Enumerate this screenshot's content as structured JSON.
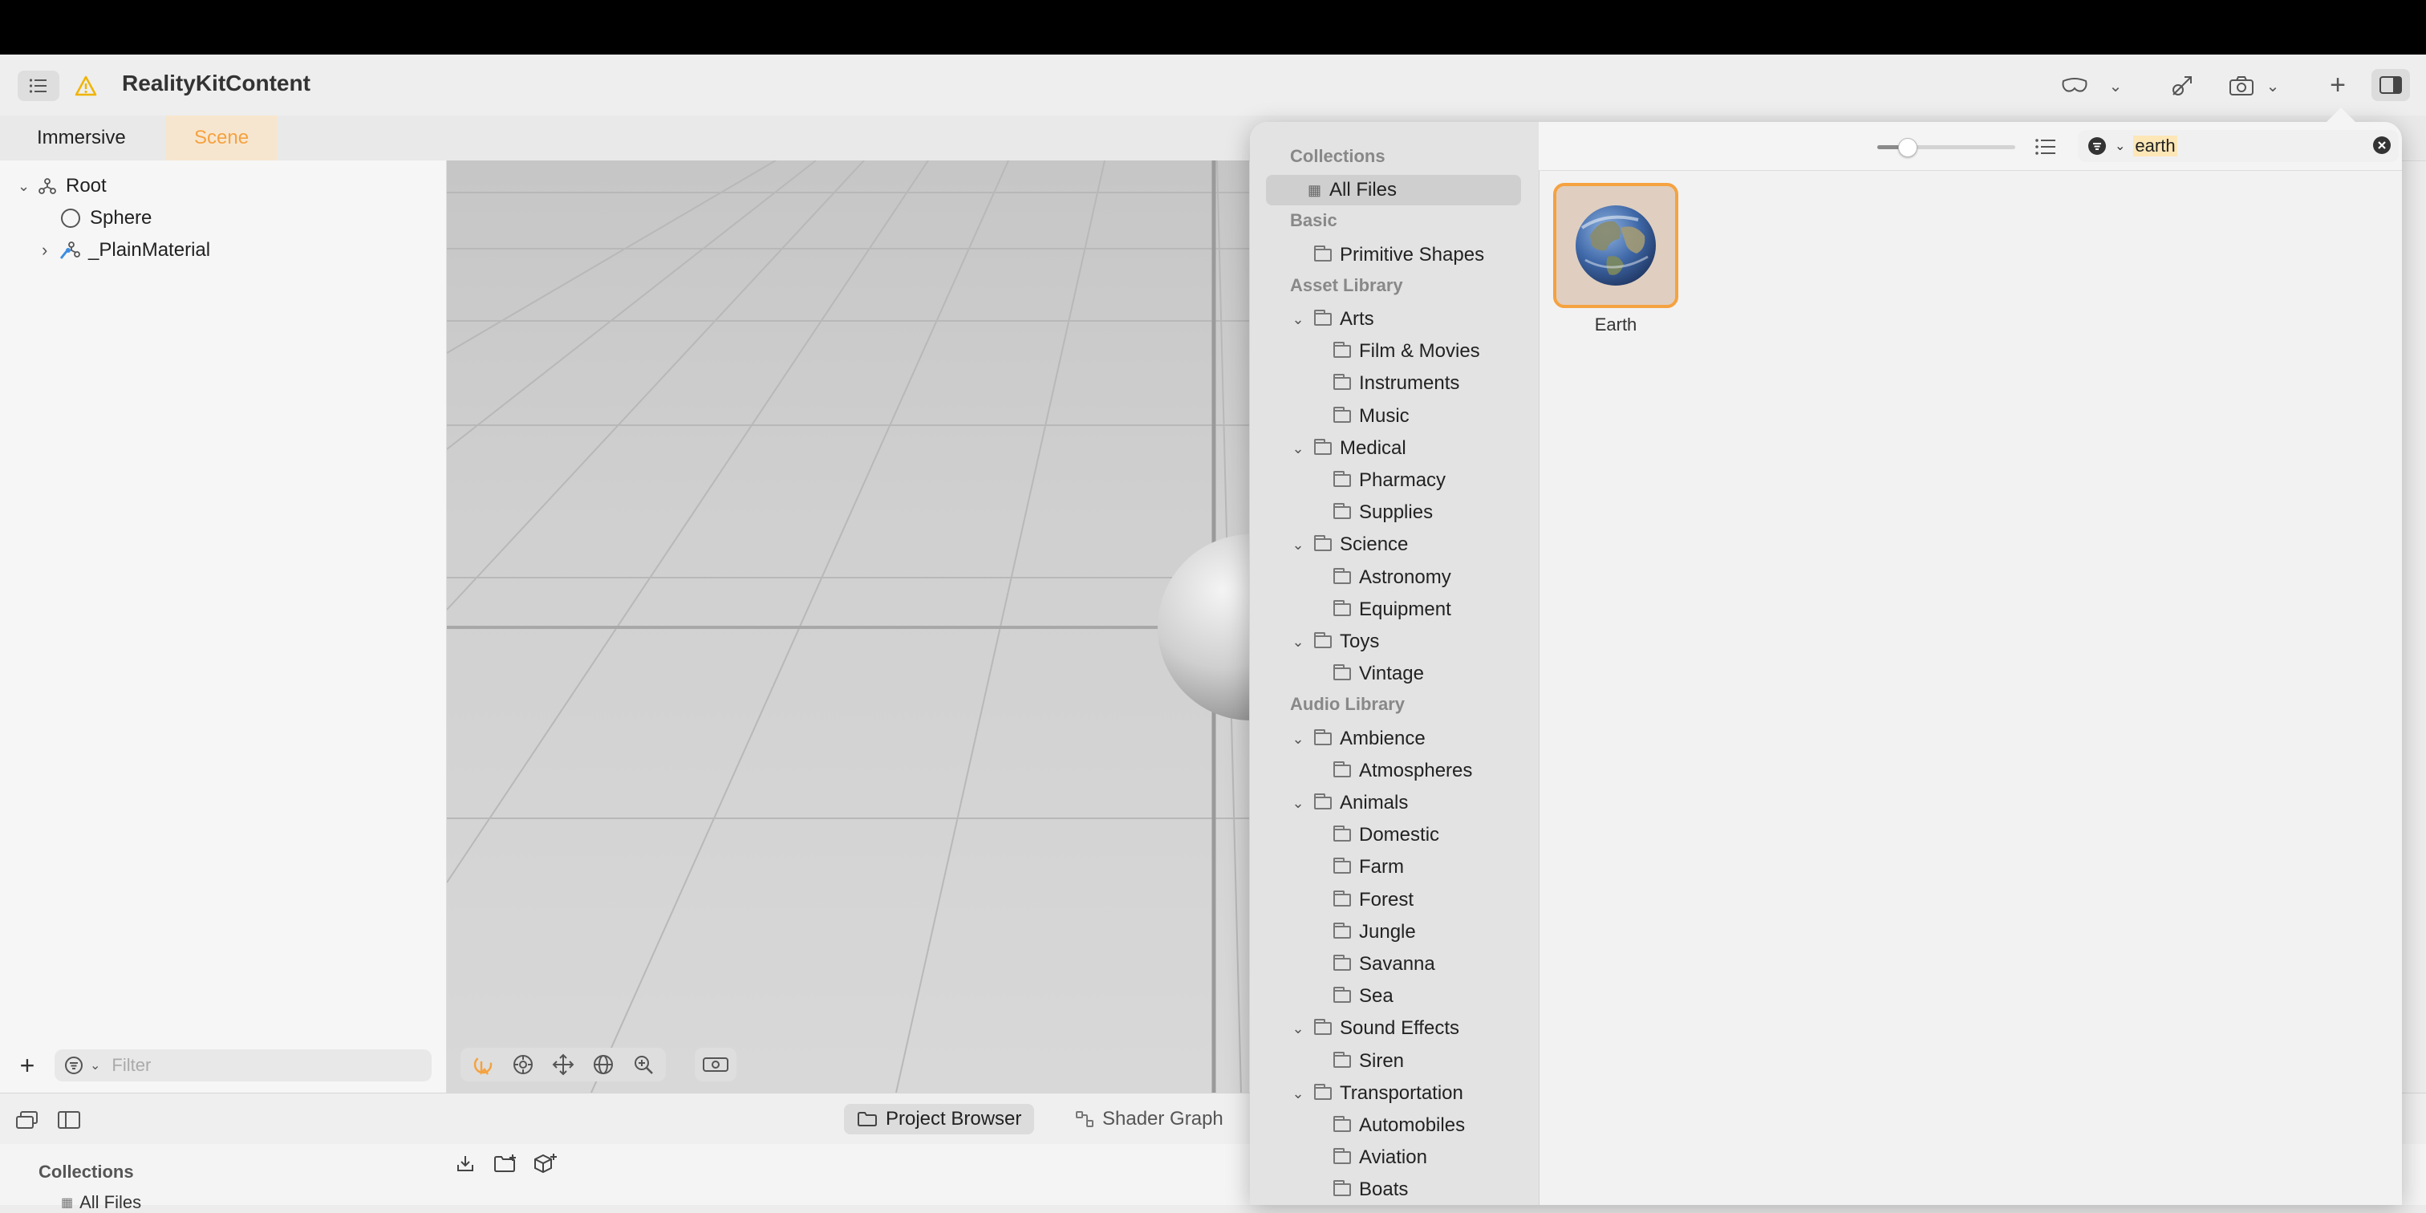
{
  "app": {
    "title": "RealityKitContent",
    "accent_color": "#f5a240",
    "warning_color": "#f0b400"
  },
  "toolbar": {
    "icons": [
      "list-icon",
      "warning-icon",
      "headset-icon",
      "chevron-down-icon",
      "transform-icon",
      "camera-icon",
      "plus-icon",
      "inspector-icon"
    ]
  },
  "scene_tabs": [
    {
      "label": "Immersive",
      "selected": false
    },
    {
      "label": "Scene",
      "selected": true
    }
  ],
  "hierarchy": {
    "items": [
      {
        "label": "Root",
        "icon": "entity-icon",
        "expanded": true
      },
      {
        "label": "Sphere",
        "icon": "sphere-icon"
      },
      {
        "label": "_PlainMaterial",
        "icon": "material-icon",
        "expanded": false
      }
    ],
    "filter_placeholder": "Filter"
  },
  "bottom_tabs": [
    {
      "label": "Project Browser",
      "icon": "folder-icon",
      "selected": true
    },
    {
      "label": "Shader Graph",
      "icon": "graph-icon",
      "selected": false
    }
  ],
  "bottom_panel": {
    "collections_label": "Collections",
    "all_files_label": "All Files"
  },
  "library": {
    "sections": [
      {
        "heading": "Collections",
        "items": [
          {
            "label": "All Files",
            "icon": "grid-icon",
            "level": 0,
            "selected": true
          }
        ]
      },
      {
        "heading": "Basic",
        "items": [
          {
            "label": "Primitive Shapes",
            "icon": "folder-icon",
            "level": 0
          }
        ]
      },
      {
        "heading": "Asset Library",
        "items": [
          {
            "label": "Arts",
            "icon": "folder-icon",
            "level": 0,
            "expanded": true
          },
          {
            "label": "Film & Movies",
            "icon": "folder-icon",
            "level": 1
          },
          {
            "label": "Instruments",
            "icon": "folder-icon",
            "level": 1
          },
          {
            "label": "Music",
            "icon": "folder-icon",
            "level": 1
          },
          {
            "label": "Medical",
            "icon": "folder-icon",
            "level": 0,
            "expanded": true
          },
          {
            "label": "Pharmacy",
            "icon": "folder-icon",
            "level": 1
          },
          {
            "label": "Supplies",
            "icon": "folder-icon",
            "level": 1
          },
          {
            "label": "Science",
            "icon": "folder-icon",
            "level": 0,
            "expanded": true
          },
          {
            "label": "Astronomy",
            "icon": "folder-icon",
            "level": 1
          },
          {
            "label": "Equipment",
            "icon": "folder-icon",
            "level": 1
          },
          {
            "label": "Toys",
            "icon": "folder-icon",
            "level": 0,
            "expanded": true
          },
          {
            "label": "Vintage",
            "icon": "folder-icon",
            "level": 1
          }
        ]
      },
      {
        "heading": "Audio Library",
        "items": [
          {
            "label": "Ambience",
            "icon": "folder-icon",
            "level": 0,
            "expanded": true
          },
          {
            "label": "Atmospheres",
            "icon": "folder-icon",
            "level": 1
          },
          {
            "label": "Animals",
            "icon": "folder-icon",
            "level": 0,
            "expanded": true
          },
          {
            "label": "Domestic",
            "icon": "folder-icon",
            "level": 1
          },
          {
            "label": "Farm",
            "icon": "folder-icon",
            "level": 1
          },
          {
            "label": "Forest",
            "icon": "folder-icon",
            "level": 1
          },
          {
            "label": "Jungle",
            "icon": "folder-icon",
            "level": 1
          },
          {
            "label": "Savanna",
            "icon": "folder-icon",
            "level": 1
          },
          {
            "label": "Sea",
            "icon": "folder-icon",
            "level": 1
          },
          {
            "label": "Sound Effects",
            "icon": "folder-icon",
            "level": 0,
            "expanded": true
          },
          {
            "label": "Siren",
            "icon": "folder-icon",
            "level": 1
          },
          {
            "label": "Transportation",
            "icon": "folder-icon",
            "level": 0,
            "expanded": true
          },
          {
            "label": "Automobiles",
            "icon": "folder-icon",
            "level": 1
          },
          {
            "label": "Aviation",
            "icon": "folder-icon",
            "level": 1
          },
          {
            "label": "Boats",
            "icon": "folder-icon",
            "level": 1
          }
        ]
      }
    ],
    "search": {
      "value": "earth"
    },
    "results": [
      {
        "label": "Earth",
        "icon": "globe-icon",
        "selected": true
      }
    ]
  }
}
